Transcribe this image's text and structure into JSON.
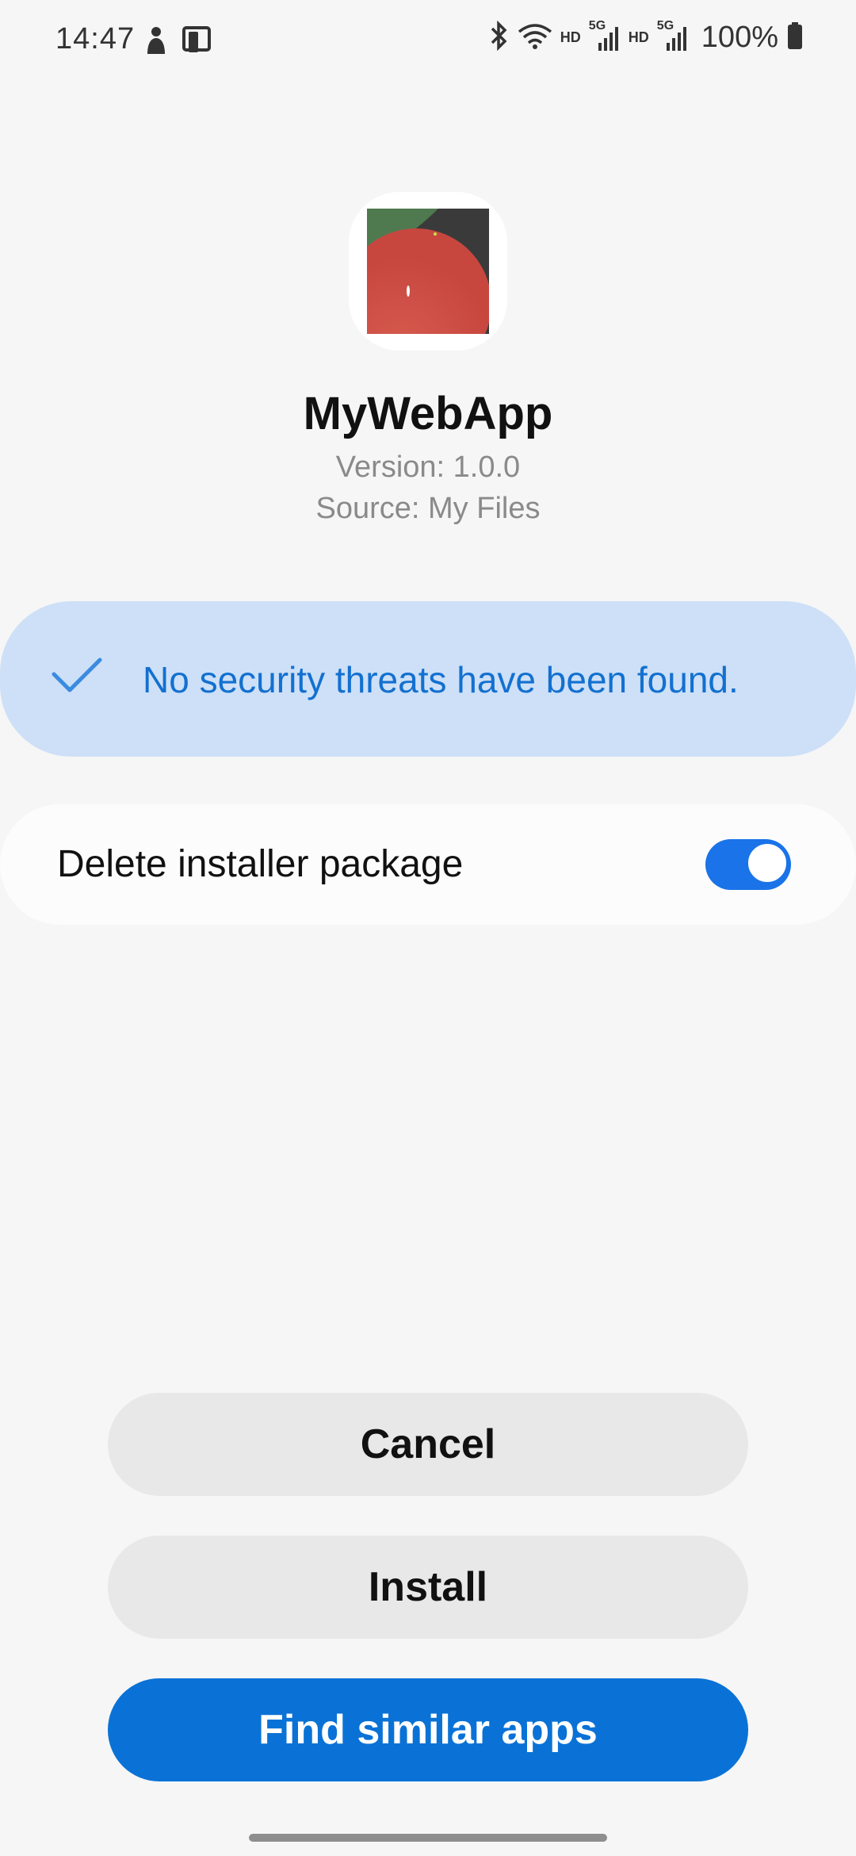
{
  "status_bar": {
    "time": "14:47",
    "left_icons": [
      "person-icon",
      "device-icon"
    ],
    "hd_label_1": "HD",
    "hd_label_2": "HD",
    "net_label_1": "5G",
    "net_label_2": "5G",
    "battery": "100%"
  },
  "app": {
    "name": "MyWebApp",
    "version": "Version: 1.0.0",
    "source": "Source: My Files"
  },
  "security": {
    "message": "No security threats have been found."
  },
  "options": {
    "delete_installer_label": "Delete installer package",
    "delete_installer_enabled": true
  },
  "buttons": {
    "cancel": "Cancel",
    "install": "Install",
    "find_similar": "Find similar apps"
  },
  "colors": {
    "accent": "#0a72d6",
    "banner_bg": "#cde0f7",
    "banner_text": "#1370d0"
  }
}
